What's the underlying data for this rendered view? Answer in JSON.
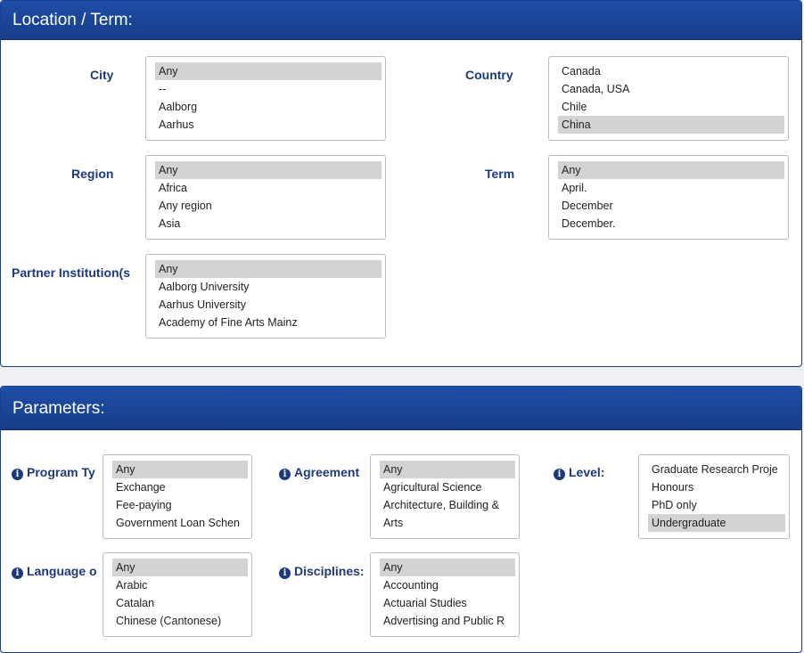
{
  "location_panel": {
    "title": "Location / Term:",
    "city": {
      "label": "City",
      "options": [
        "Any",
        "--",
        "Aalborg",
        "Aarhus"
      ],
      "selected": "Any"
    },
    "country": {
      "label": "Country",
      "options": [
        "Canada",
        "Canada, USA",
        "Chile",
        "China"
      ],
      "selected": "China"
    },
    "region": {
      "label": "Region",
      "options": [
        "Any",
        "Africa",
        "Any region",
        "Asia"
      ],
      "selected": "Any"
    },
    "term": {
      "label": "Term",
      "options": [
        "Any",
        "April.",
        "December",
        "December."
      ],
      "selected": "Any"
    },
    "partner": {
      "label": "Partner Institution(s",
      "options": [
        "Any",
        "Aalborg University",
        "Aarhus University",
        "Academy of Fine Arts Mainz"
      ],
      "selected": "Any"
    }
  },
  "parameters_panel": {
    "title": "Parameters:",
    "program_type": {
      "label": "Program Ty",
      "options": [
        "Any",
        "Exchange",
        "Fee-paying",
        "Government Loan Schen"
      ],
      "selected": "Any"
    },
    "agreement": {
      "label": "Agreement",
      "options": [
        "Any",
        "Agricultural Science",
        "Architecture, Building &",
        "Arts"
      ],
      "selected": "Any"
    },
    "level": {
      "label": "Level:",
      "options": [
        "Graduate Research Proje",
        "Honours",
        "PhD only",
        "Undergraduate"
      ],
      "selected": "Undergraduate"
    },
    "language": {
      "label": "Language o",
      "options": [
        "Any",
        "Arabic",
        "Catalan",
        "Chinese (Cantonese)"
      ],
      "selected": "Any"
    },
    "disciplines": {
      "label": "Disciplines:",
      "options": [
        "Any",
        "Accounting",
        "Actuarial Studies",
        "Advertising and Public R"
      ],
      "selected": "Any"
    }
  },
  "icons": {
    "info": "i"
  },
  "colors": {
    "header_bg": "#1f4ea6",
    "label_text": "#1b3a7c",
    "selected_option_bg": "#d3d3d3"
  }
}
